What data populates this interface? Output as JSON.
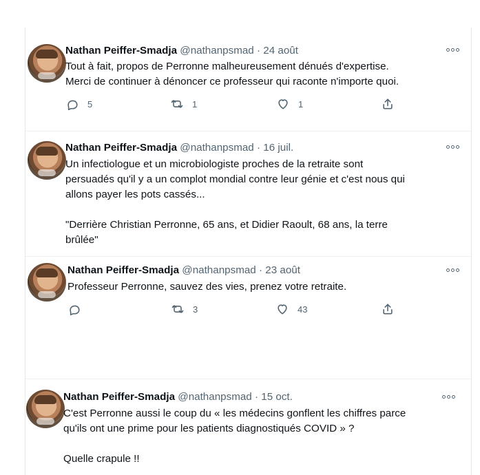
{
  "tweets": [
    {
      "author": "Nathan Peiffer-Smadja",
      "handle": "@nathanpsmad",
      "date": "24 août",
      "text": "Tout à fait, propos de Perronne malheureusement dénués d'expertise.\nMerci de continuer à dénoncer ce professeur qui raconte n'importe quoi.",
      "stats": {
        "replies": "5",
        "retweets": "1",
        "likes": "1"
      }
    },
    {
      "author": "Nathan Peiffer-Smadja",
      "handle": "@nathanpsmad",
      "date": "16 juil.",
      "text": "Un infectiologue et un microbiologiste proches de la retraite sont\npersuadés qu'il y a un complot mondial contre leur génie et c'est nous qui\nallons payer les pots cassés...\n\n\"Derrière Christian Perronne, 65 ans, et Didier Raoult, 68 ans, la terre\nbrûlée\""
    },
    {
      "author": "Nathan Peiffer-Smadja",
      "handle": "@nathanpsmad",
      "date": "23 août",
      "text": "Professeur Perronne, sauvez des vies, prenez votre retraite.",
      "stats": {
        "replies": "",
        "retweets": "3",
        "likes": "43"
      }
    },
    {
      "author": "Nathan Peiffer-Smadja",
      "handle": "@nathanpsmad",
      "date": "15 oct.",
      "text": "C'est Perronne aussi le coup du « les médecins gonflent les chiffres parce\nqu'ils ont une prime pour les patients diagnostiqués COVID » ?\n\nQuelle crapule !!"
    }
  ],
  "icons": {
    "reply": "reply-icon",
    "retweet": "retweet-icon",
    "like": "heart-icon",
    "share": "share-icon",
    "more": "more-icon"
  }
}
